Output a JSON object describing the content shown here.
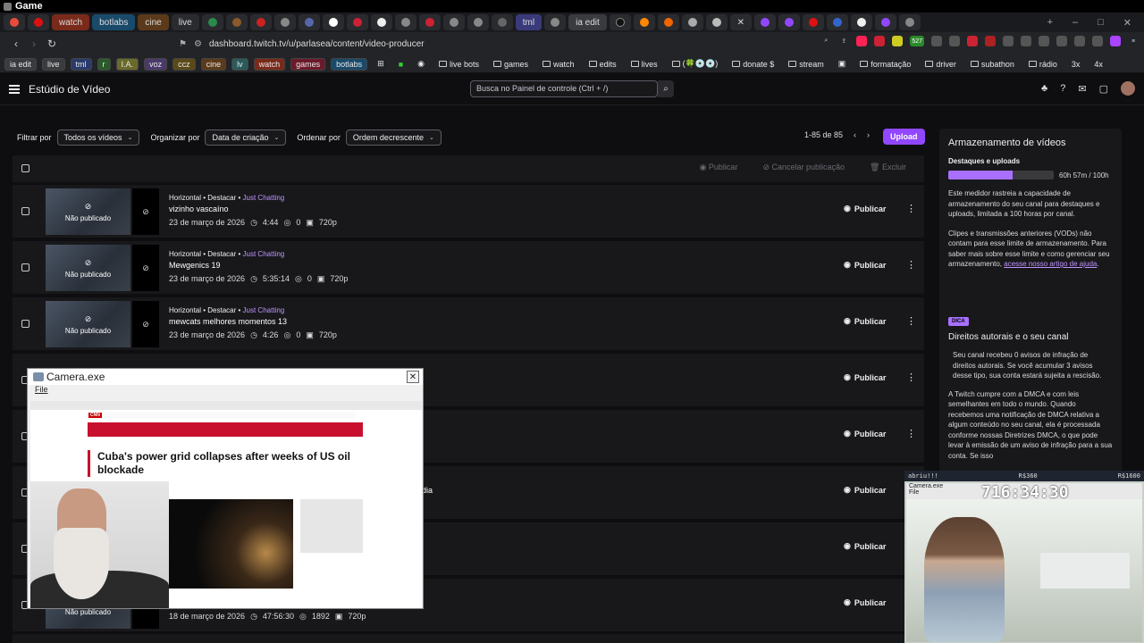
{
  "os": {
    "title": "Game"
  },
  "tabs": {
    "labels": [
      "watch",
      "botlabs",
      "cine",
      "live",
      "tml",
      "ia edit"
    ]
  },
  "address": {
    "url": "dashboard.twitch.tv/u/parlasea/content/video-producer",
    "ext_badge": "527"
  },
  "bookmarks": {
    "items": [
      "ia edit",
      "live",
      "tml",
      "r",
      "I.A.",
      "voz",
      "ccz",
      "cine",
      "lv",
      "watch",
      "games",
      "botlabs",
      "live bots",
      "games",
      "watch",
      "edits",
      "lives",
      "(🍀💿💿)",
      "donate $",
      "stream",
      "formatação",
      "driver",
      "subathon",
      "rádio",
      "3x",
      "4x"
    ]
  },
  "header": {
    "title": "Estúdio de Vídeo",
    "search_placeholder": "Busca no Painel de controle (Ctrl + /)"
  },
  "filters": {
    "filter_label": "Filtrar por",
    "filter_value": "Todos os vídeos",
    "organize_label": "Organizar por",
    "organize_value": "Data de criação",
    "order_label": "Ordenar por",
    "order_value": "Ordem decrescente",
    "pager": "1-85 de 85",
    "upload": "Upload"
  },
  "bulk": {
    "publish": "Publicar",
    "unpublish": "Cancelar publicação",
    "delete": "Excluir"
  },
  "rows": [
    {
      "meta": "Horizontal • Destacar • ",
      "category": "Just Chatting",
      "title": "vizinho vascaíno",
      "date": "23 de março de 2026",
      "duration": "4:44",
      "views": "0",
      "quality": "720p",
      "status": "Não publicado",
      "action": "Publicar"
    },
    {
      "meta": "Horizontal • Destacar • ",
      "category": "Just Chatting",
      "title": "Mewgenics 19",
      "date": "23 de março de 2026",
      "duration": "5:35:14",
      "views": "0",
      "quality": "720p",
      "status": "Não publicado",
      "action": "Publicar"
    },
    {
      "meta": "Horizontal • Destacar • ",
      "category": "Just Chatting",
      "title": "mewcats melhores momentos 13",
      "date": "23 de março de 2026",
      "duration": "4:26",
      "views": "0",
      "quality": "720p",
      "status": "Não publicado",
      "action": "Publicar"
    },
    {
      "action": "Publicar"
    },
    {
      "action": "Publicar"
    },
    {
      "action": "Publicar",
      "title_fragment": "dia"
    },
    {
      "action": "Publicar"
    },
    {
      "action": "Publicar"
    },
    {
      "date": "18 de março de 2026",
      "duration": "47:56:30",
      "views": "1892",
      "quality": "720p",
      "status": "Não publicado",
      "action": "Publicar"
    }
  ],
  "storage": {
    "title": "Armazenamento de vídeos",
    "subtitle": "Destaques e uploads",
    "usage": "60h 57m / 100h",
    "usage_fraction": 0.61,
    "p1": "Este medidor rastreia a capacidade de armazenamento do seu canal para destaques e uploads, limitada a 100 horas por canal.",
    "p2": "Clipes e transmissões anteriores (VODs) não contam para esse limite de armazenamento. Para saber mais sobre esse limite e como gerenciar seu armazenamento,",
    "link": "acesse nosso artigo de ajuda"
  },
  "tip": {
    "badge": "DICA",
    "title": "Direitos autorais e o seu canal",
    "p1": "Seu canal recebeu 0 avisos de infração de direitos autorais. Se você acumular 3 avisos desse tipo, sua conta estará sujeita a rescisão.",
    "p2": "A Twitch cumpre com a DMCA e com leis semelhantes em todo o mundo. Quando recebemos uma notificação de DMCA relativa a algum conteúdo no seu canal, ela é processada conforme nossas",
    "link": "Diretrizes DMCA",
    "p3": ", o que pode levar à emissão de um aviso de infração para a sua conta. Se isso"
  },
  "camera": {
    "title": "Camera.exe",
    "menu": "File",
    "headline": "Cuba's power grid collapses after weeks of US oil blockade"
  },
  "webcam": {
    "left_label": "abriu!!!",
    "mid_label": "R$360",
    "right_label": "R$1600",
    "window_title": "Camera.exe",
    "window_menu": "File",
    "timer": "716:34:30"
  }
}
